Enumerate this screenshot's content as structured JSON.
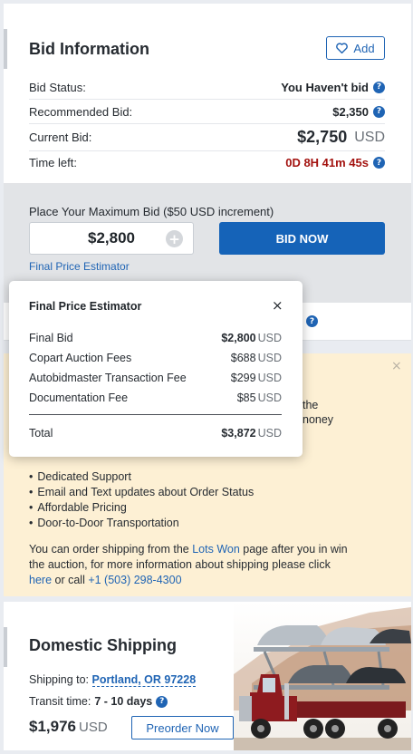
{
  "bid_info": {
    "title": "Bid Information",
    "add_label": "Add",
    "rows": {
      "status": {
        "label": "Bid Status:",
        "value": "You Haven't bid"
      },
      "recommended": {
        "label": "Recommended Bid:",
        "value": "$2,350"
      },
      "current": {
        "label": "Current Bid:",
        "amount": "$2,750",
        "currency": "USD"
      },
      "time_left": {
        "label": "Time left:",
        "value": "0D 8H 41m 45s"
      }
    },
    "help_icon_text": "?"
  },
  "place_bid": {
    "caption": "Place Your Maximum Bid ($50 USD increment)",
    "input_value": "$2,800",
    "plus_label": "+",
    "bid_now_label": "BID NOW",
    "estimator_link": "Final Price Estimator"
  },
  "estimator_popup": {
    "title": "Final Price Estimator",
    "close_label": "×",
    "items": [
      {
        "label": "Final Bid",
        "amount": "$2,800",
        "currency": "USD",
        "bold": true
      },
      {
        "label": "Copart Auction Fees",
        "amount": "$688",
        "currency": "USD"
      },
      {
        "label": "Autobidmaster Transaction Fee",
        "amount": "$299",
        "currency": "USD"
      },
      {
        "label": "Documentation Fee",
        "amount": "$85",
        "currency": "USD"
      }
    ],
    "total": {
      "label": "Total",
      "amount": "$3,872",
      "currency": "USD"
    }
  },
  "shipping_promo": {
    "close_label": "×",
    "partial_line_1": "the",
    "partial_line_2": "noney",
    "bullets": [
      "Dedicated Support",
      "Email and Text updates about Order Status",
      "Affordable Pricing",
      "Door-to-Door Transportation"
    ],
    "para_1": "You can order shipping from the ",
    "lots_won_link": "Lots Won",
    "para_2": " page after you in win the auction, for more information about shipping please click ",
    "here_link": "here",
    "para_3": " or call ",
    "phone_link": "+1 (503) 298-4300"
  },
  "domestic_shipping": {
    "title": "Domestic Shipping",
    "shipping_to_label": "Shipping to:",
    "location": "Portland, OR 97228",
    "transit_label": "Transit time:",
    "transit_value": "7 - 10 days",
    "price": "$1,976",
    "currency": "USD",
    "preorder_label": "Preorder Now"
  },
  "colors": {
    "primary_blue": "#1563b8",
    "time_red": "#a3120f",
    "promo_bg": "#fdf0d4"
  }
}
